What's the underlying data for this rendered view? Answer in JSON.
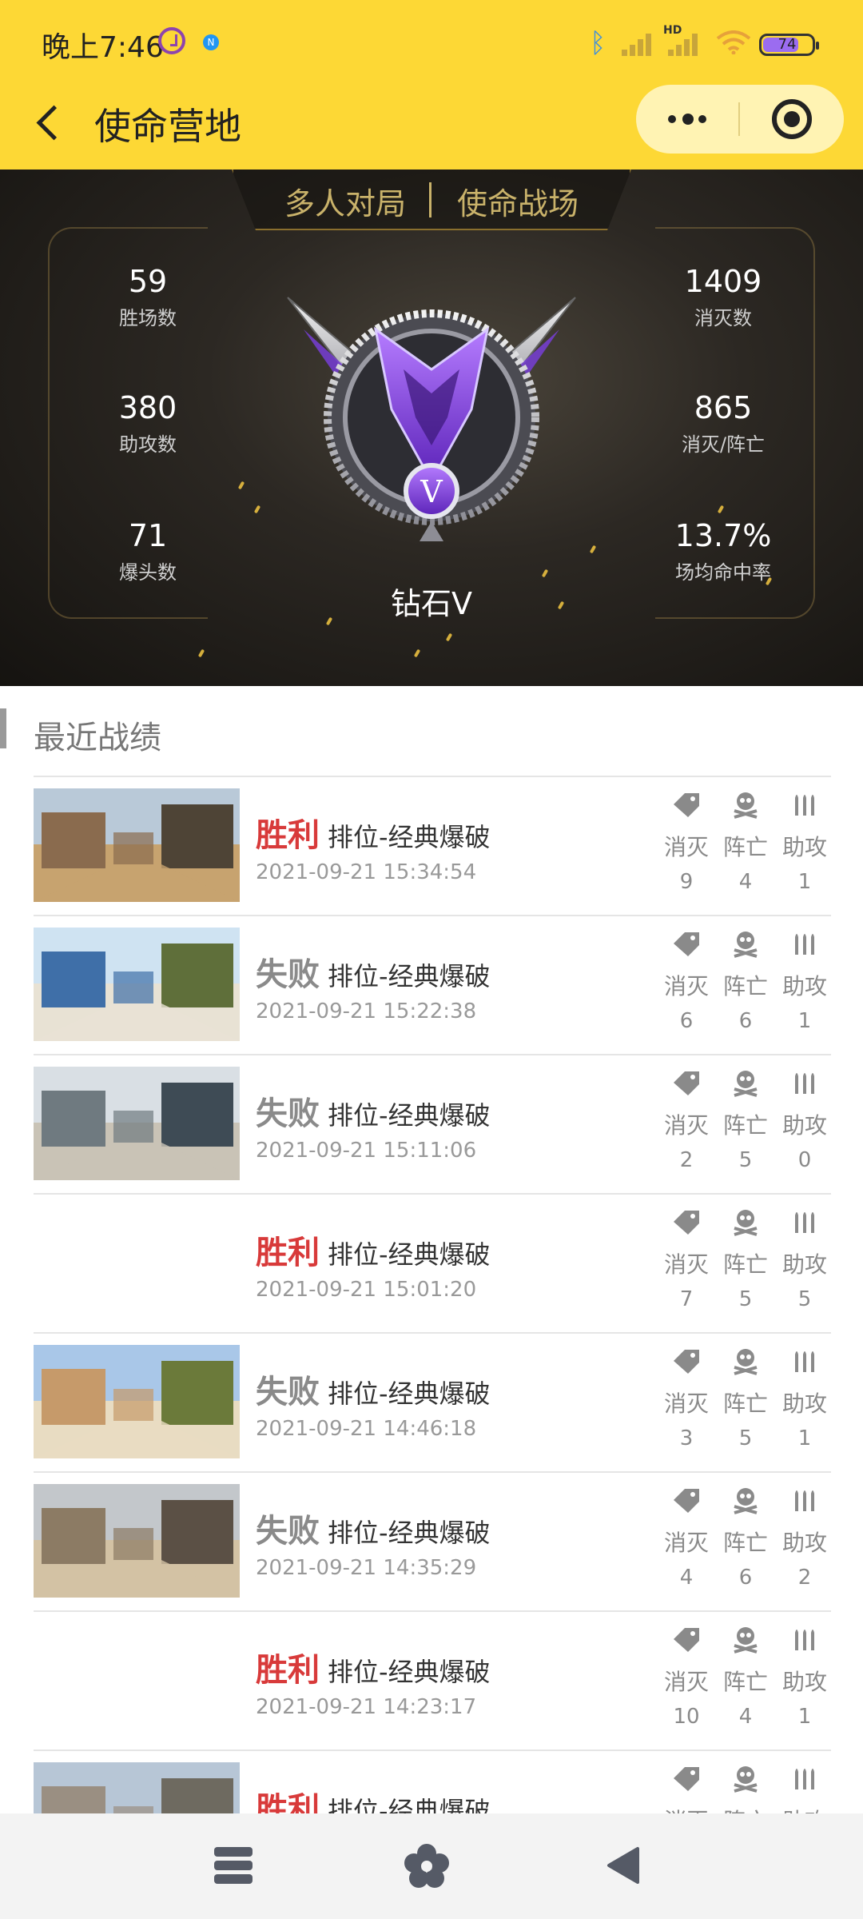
{
  "status_bar": {
    "time": "晚上7:46",
    "battery": "74",
    "network_label": "HD"
  },
  "nav": {
    "title": "使命营地"
  },
  "hero": {
    "tabs": [
      "多人对局",
      "使命战场"
    ],
    "left_stats": [
      {
        "value": "59",
        "label": "胜场数"
      },
      {
        "value": "380",
        "label": "助攻数"
      },
      {
        "value": "71",
        "label": "爆头数"
      }
    ],
    "right_stats": [
      {
        "value": "1409",
        "label": "消灭数"
      },
      {
        "value": "865",
        "label": "消灭/阵亡"
      },
      {
        "value": "13.7%",
        "label": "场均命中率"
      }
    ],
    "rank": "钻石V",
    "rank_numeral": "V"
  },
  "section": {
    "title": "最近战绩"
  },
  "stat_labels": {
    "kills": "消灭",
    "deaths": "阵亡",
    "assists": "助攻"
  },
  "matches": [
    {
      "result": "胜利",
      "mode": "排位-经典爆破",
      "time": "2021-09-21 15:34:54",
      "kills": "9",
      "deaths": "4",
      "assists": "1"
    },
    {
      "result": "失败",
      "mode": "排位-经典爆破",
      "time": "2021-09-21 15:22:38",
      "kills": "6",
      "deaths": "6",
      "assists": "1"
    },
    {
      "result": "失败",
      "mode": "排位-经典爆破",
      "time": "2021-09-21 15:11:06",
      "kills": "2",
      "deaths": "5",
      "assists": "0"
    },
    {
      "result": "胜利",
      "mode": "排位-经典爆破",
      "time": "2021-09-21 15:01:20",
      "kills": "7",
      "deaths": "5",
      "assists": "5"
    },
    {
      "result": "失败",
      "mode": "排位-经典爆破",
      "time": "2021-09-21 14:46:18",
      "kills": "3",
      "deaths": "5",
      "assists": "1"
    },
    {
      "result": "失败",
      "mode": "排位-经典爆破",
      "time": "2021-09-21 14:35:29",
      "kills": "4",
      "deaths": "6",
      "assists": "2"
    },
    {
      "result": "胜利",
      "mode": "排位-经典爆破",
      "time": "2021-09-21 14:23:17",
      "kills": "10",
      "deaths": "4",
      "assists": "1"
    },
    {
      "result": "胜利",
      "mode": "排位-经典爆破",
      "time": "",
      "kills": "",
      "deaths": "",
      "assists": ""
    }
  ],
  "colors": {
    "accent_yellow": "#fdd835",
    "win_red": "#d83a3a",
    "lose_gray": "#8a8a8a",
    "hero_gold": "#c9b26a",
    "emblem_purple": "#7b3fe0"
  },
  "icons": {
    "kills": "tag-icon",
    "deaths": "skull-icon",
    "assists": "bullets-icon"
  }
}
